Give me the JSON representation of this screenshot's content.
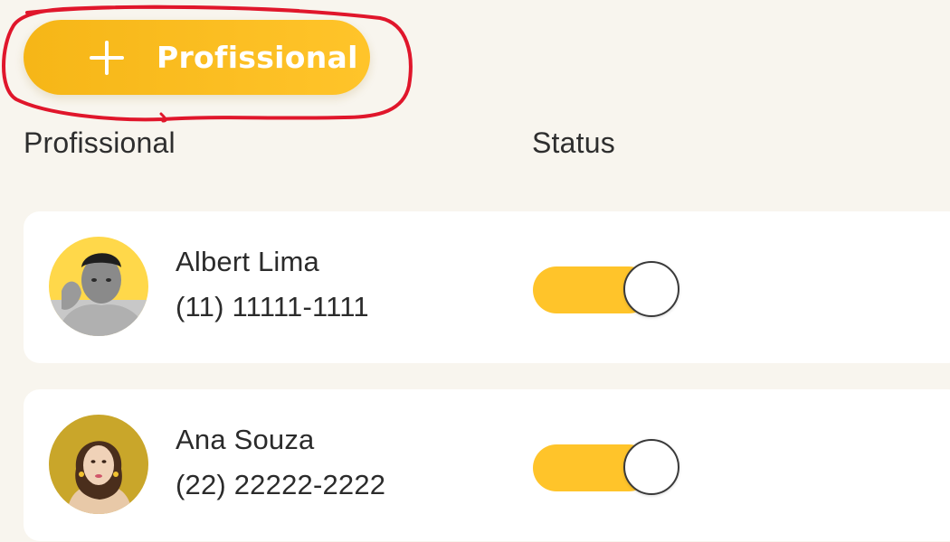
{
  "add_button": {
    "label": "Profissional",
    "icon": "plus-icon"
  },
  "table": {
    "columns": [
      "Profissional",
      "Status"
    ],
    "rows": [
      {
        "name": "Albert Lima",
        "phone": "(11) 11111-1111",
        "status_on": true,
        "avatar": "avatar-photo"
      },
      {
        "name": "Ana Souza",
        "phone": "(22) 22222-2222",
        "status_on": true,
        "avatar": "avatar-photo"
      }
    ]
  },
  "colors": {
    "accent": "#ffc42a",
    "background": "#f8f5ee",
    "highlight": "#e0162b"
  }
}
